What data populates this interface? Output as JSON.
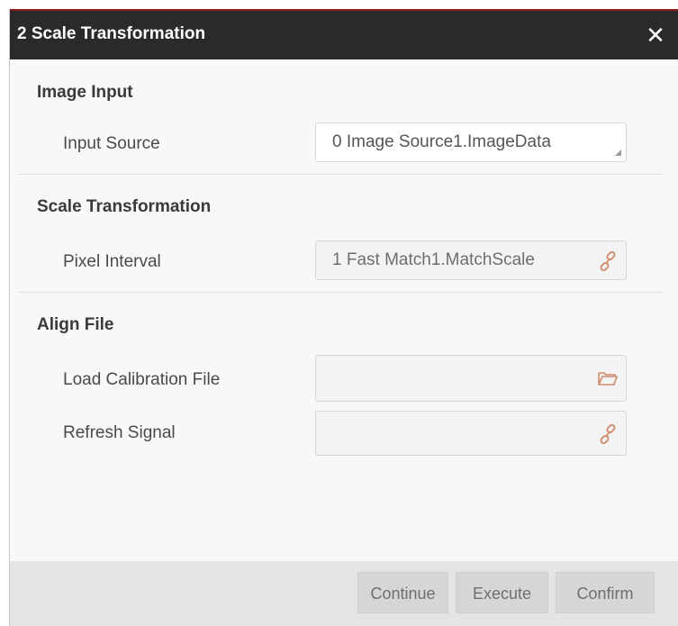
{
  "dialog": {
    "title": "2 Scale Transformation",
    "close_glyph": "✕"
  },
  "sections": {
    "image_input": {
      "title": "Image Input",
      "input_source": {
        "label": "Input Source",
        "value": "0 Image Source1.ImageData"
      }
    },
    "scale_transformation": {
      "title": "Scale Transformation",
      "pixel_interval": {
        "label": "Pixel Interval",
        "value": "1 Fast Match1.MatchScale",
        "icon": "link-icon"
      }
    },
    "align_file": {
      "title": "Align File",
      "load_calibration_file": {
        "label": "Load Calibration File",
        "value": "",
        "icon": "folder-open-icon"
      },
      "refresh_signal": {
        "label": "Refresh Signal",
        "value": "",
        "icon": "link-icon"
      }
    }
  },
  "footer": {
    "continue_label": "Continue",
    "execute_label": "Execute",
    "confirm_label": "Confirm"
  },
  "colors": {
    "titlebar_bg": "#2a2a2a",
    "titlebar_accent": "#8b1d1d",
    "panel_bg": "#f8f8f8",
    "footer_bg": "#e4e4e4",
    "icon_color": "#d08a6a"
  }
}
